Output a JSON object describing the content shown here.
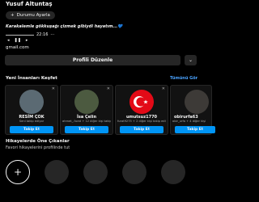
{
  "profile": {
    "name": "Yusuf Altuntaş",
    "status_label": "Durumu Ayarla",
    "bio": "Karakalemle gökkuşağı çizmek gibiydi hayatım...💙",
    "audio_time": "22:16",
    "email": "gmail.com",
    "edit_label": "Profili Düzenle"
  },
  "discover": {
    "title": "Yeni İnsanları Keşfet",
    "see_all": "Tümünü Gör",
    "cards": [
      {
        "name": "RESİM ÇOK",
        "sub": "Seni takip ediyor",
        "follow": "Takip Et"
      },
      {
        "name": "İsa Çelin",
        "sub": "ahmet_.furat + 12 diğer kişi takip ediyor",
        "follow": "Takip Et"
      },
      {
        "name": "umutsuz1770",
        "sub": "furat9275 + 2 diğer kişi takip ediyor",
        "follow": "Takip Et"
      },
      {
        "name": "obirurfa63",
        "sub": "obir_urfa + 4 diğer kişi",
        "follow": "Takip Et"
      }
    ]
  },
  "highlights": {
    "title": "Hikayelerde Öne Çıkanlar",
    "subtitle": "Favori hikayelerini profilinde tut"
  }
}
